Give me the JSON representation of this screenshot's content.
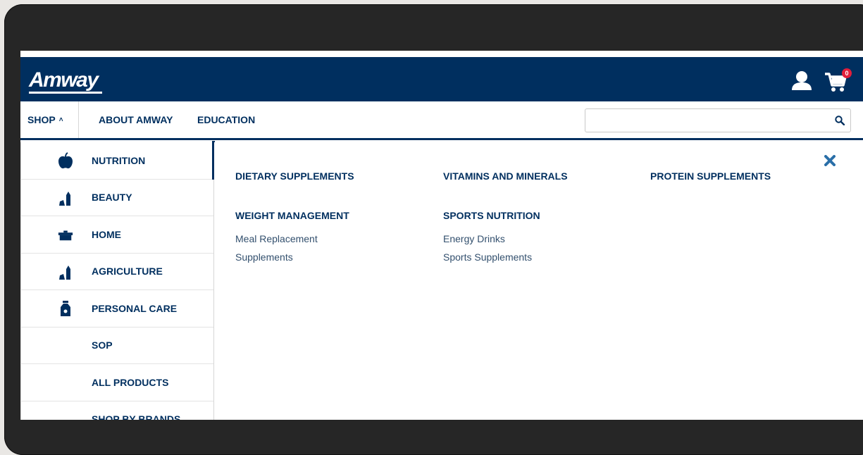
{
  "header": {
    "logo_text": "Amway",
    "user_icon": "user-icon",
    "cart_icon": "cart-icon",
    "cart_count": "0",
    "brand_color": "#002f5f",
    "badge_color": "#e31e3b"
  },
  "nav": {
    "shop_label": "SHOP",
    "about_label": "ABOUT AMWAY",
    "education_label": "EDUCATION",
    "search_placeholder": "",
    "search_icon": "search-icon"
  },
  "left_menu": {
    "items": [
      {
        "label": "NUTRITION",
        "icon": "apple-icon",
        "active": true
      },
      {
        "label": "BEAUTY",
        "icon": "lipstick-icon"
      },
      {
        "label": "HOME",
        "icon": "pot-icon"
      },
      {
        "label": "AGRICULTURE",
        "icon": "lipstick-icon"
      },
      {
        "label": "PERSONAL CARE",
        "icon": "soap-bottle-icon"
      },
      {
        "label": "SOP",
        "icon": ""
      },
      {
        "label": "ALL PRODUCTS",
        "icon": ""
      },
      {
        "label": "SHOP BY BRANDS",
        "icon": ""
      }
    ]
  },
  "mega_menu": {
    "columns": [
      {
        "title": "DIETARY SUPPLEMENTS"
      },
      {
        "title": "VITAMINS AND MINERALS"
      },
      {
        "title": "PROTEIN SUPPLEMENTS"
      },
      {
        "title": "WEIGHT MANAGEMENT",
        "links": [
          "Meal Replacement",
          "Supplements"
        ]
      },
      {
        "title": "SPORTS NUTRITION",
        "links": [
          "Energy Drinks",
          "Sports Supplements"
        ]
      }
    ],
    "close_icon": "close-icon"
  }
}
